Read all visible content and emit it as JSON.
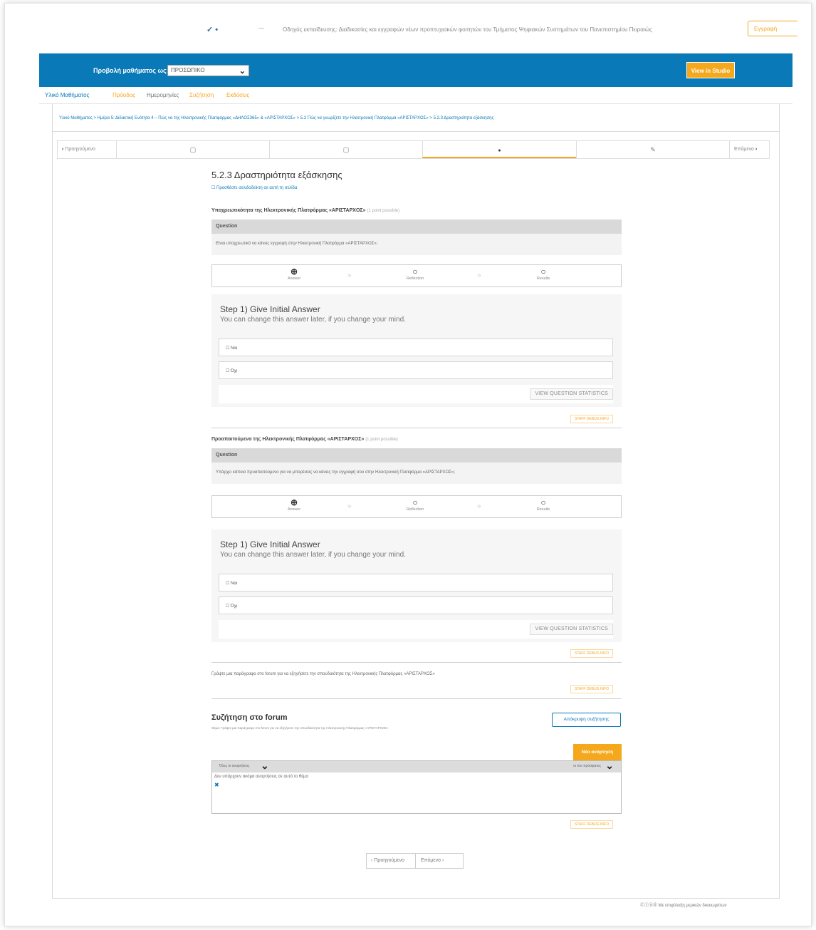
{
  "header": {
    "logo_glyph": "✓ •",
    "dash": "—",
    "course_title": "Οδηγός εκπαίδευσης: Διαδικασίες και εγγραφών νέων προπτυχιακών φοιτητών του Τμήματος Ψηφιακών Συστημάτων του Πανεπιστημίου Πειραιώς",
    "signin_label": "Εγγραφή"
  },
  "view_bar": {
    "view_as_label": "Προβολή μαθήματος ως:",
    "view_as_value": "ΠΡΟΣΩΠΙΚΟ",
    "studio_button": "View in Studio",
    "bar_color": "#0979b8",
    "accent_color": "#f5a81c"
  },
  "tabs": [
    {
      "label": "Υλικό Μαθήματος",
      "style": "t-active"
    },
    {
      "label": "Πρόοδος",
      "style": "t-orange"
    },
    {
      "label": "Ημερομηνίες",
      "style": "t-gray"
    },
    {
      "label": "Συζήτηση",
      "style": "t-orange"
    },
    {
      "label": "Εκδόσεις",
      "style": "t-orange"
    }
  ],
  "breadcrumb": "Υλικό Μαθήματος > Ημέρα 5: Διδακτική Ενότητα 4 – Πώς να της Ηλεκτρονικής Πλατφόρμας «ΔΗΛΟΣ365» & «ΑΡΙΣΤΑΡΧΟΣ» > 5.2 Πώς να γνωρίζετε την Ηλεκτρονική Πλατφόρμα «ΑΡΙΣΤΑΡΧΟΣ» > 5.2.3 Δραστηριότητα εξάσκησης",
  "sequence_nav": {
    "prev_label": "Προηγούμενο",
    "next_label": "Επόμενο",
    "prev_icon": "chevron-left-icon",
    "next_icon": "chevron-right-icon",
    "units": [
      {
        "icon": "▢",
        "icon_name": "document-icon"
      },
      {
        "icon": "▢",
        "icon_name": "document-icon"
      },
      {
        "icon": "●",
        "icon_name": "problem-icon"
      },
      {
        "icon": "✎",
        "icon_name": "edit-icon"
      }
    ]
  },
  "unit": {
    "title": "5.2.3 Δραστηριότητα εξάσκησης",
    "bookmark": "☐ Προσθέστε σελιδοδείκτη σε αυτή τη σελίδα"
  },
  "problems": [
    {
      "title": "Υποχρεωτικότητα της Ηλεκτρονικής Πλατφόρμας «ΑΡΙΣΤΑΡΧΟΣ»",
      "points": "(1 point possible)",
      "question_label": "Question",
      "question": "Είναι υποχρεωτικό να κάνεις εγγραφή στην Ηλεκτρονική Πλατφόρμα «ΑΡΙΣΤΑΡΧΟΣ»;",
      "steps": [
        "Answer",
        "Reflection",
        "Results"
      ],
      "step_heading": "Step 1) Give Initial Answer",
      "step_sub": "You can change this answer later, if you change your mind.",
      "options": [
        "☐ Ναι",
        "☐ Όχι"
      ],
      "stats_button": "VIEW QUESTION STATISTICS",
      "staff_label": "STAFF DEBUG INFO"
    },
    {
      "title": "Προαπαιτούμενα της Ηλεκτρονικής Πλατφόρμας «ΑΡΙΣΤΑΡΧΟΣ»",
      "points": "(1 point possible)",
      "question_label": "Question",
      "question": "Υπάρχει κάποιο προαπαιτούμενο για να μπορέσεις να κάνεις την εγγραφή σου στην Ηλεκτρονική Πλατφόρμα «ΑΡΙΣΤΑΡΧΟΣ»;",
      "steps": [
        "Answer",
        "Reflection",
        "Results"
      ],
      "step_heading": "Step 1) Give Initial Answer",
      "step_sub": "You can change this answer later, if you change your mind.",
      "options": [
        "☐ Ναι",
        "☐ Όχι"
      ],
      "stats_button": "VIEW QUESTION STATISTICS",
      "staff_label": "STAFF DEBUG INFO"
    }
  ],
  "forum_intro": {
    "text": "Γράψτε μια παράγραφο στο forum για να εξηγήσετε την σπουδαιότητα της Ηλεκτρονικής Πλατφόρμας «ΑΡΙΣΤΑΡΧΟΣ»",
    "staff_label": "STAFF DEBUG INFO"
  },
  "forum": {
    "title": "Συζήτηση στο forum",
    "topic": "Θέμα: Γράψτε μια παράγραφο στο forum για να εξηγήσετε την σπουδαιότητα της Ηλεκτρονικής Πλατφόρμας «ΑΡΙΣΤΑΡΧΟΣ»",
    "hide_button": "Απόκρυψη συζήτησης",
    "new_button": "Νέα ανάρτηση",
    "filter_left": "Όλες οι αναρτήσεις",
    "filter_right": "οι πιο πρόσφατες",
    "empty_text": "Δεν υπάρχουν ακόμα αναρτήσεις σε αυτό το θέμα",
    "x_glyph": "✖",
    "staff_label": "STAFF DEBUG INFO"
  },
  "bottom_nav": {
    "prev_label": "‹  Προηγούμενο",
    "next_label": "Επόμενο  ›"
  },
  "license": "Ⓒ①⑤⓪ Με επιφύλαξη μερικών δικαιωμάτων"
}
